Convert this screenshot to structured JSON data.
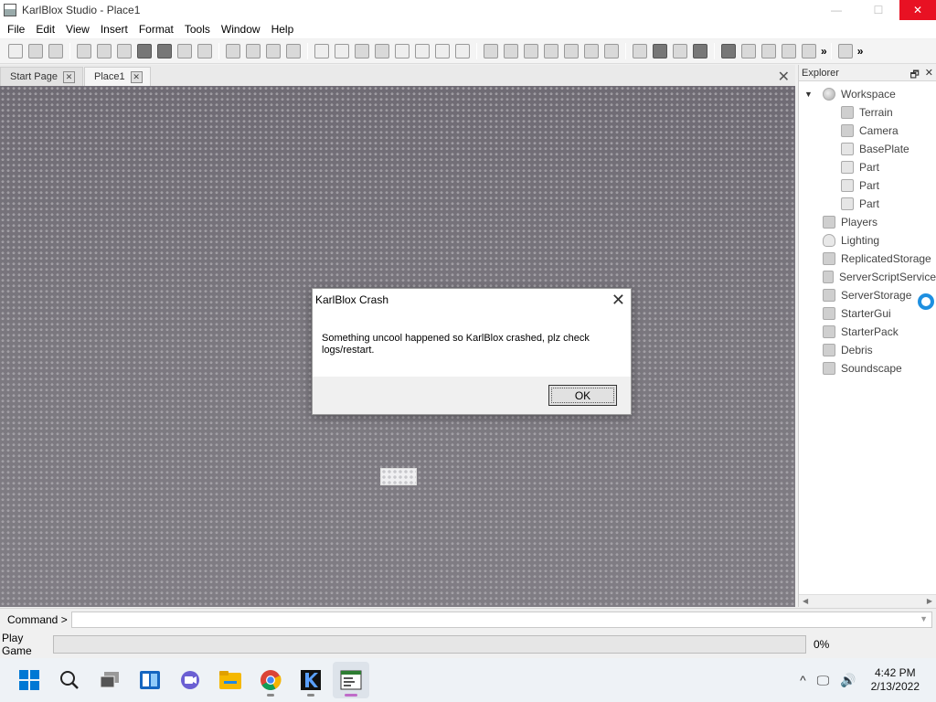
{
  "window": {
    "title": "KarlBlox Studio - Place1",
    "minimize": "—",
    "maximize": "☐",
    "close": "✕"
  },
  "menu": [
    "File",
    "Edit",
    "View",
    "Insert",
    "Format",
    "Tools",
    "Window",
    "Help"
  ],
  "toolbar": {
    "overflow": "»"
  },
  "tabs": [
    {
      "label": "Start Page",
      "close": "✕"
    },
    {
      "label": "Place1",
      "close": "✕"
    }
  ],
  "tabs_close_all": "✕",
  "explorer": {
    "title": "Explorer",
    "float_icon": "🗗",
    "close_icon": "✕",
    "items": [
      {
        "label": "Workspace",
        "icon": "globe-icon",
        "level": 0,
        "expanded": true
      },
      {
        "label": "Terrain",
        "icon": "terrain-icon",
        "level": 1
      },
      {
        "label": "Camera",
        "icon": "camera-icon",
        "level": 1
      },
      {
        "label": "BasePlate",
        "icon": "part-icon",
        "level": 1
      },
      {
        "label": "Part",
        "icon": "part-icon",
        "level": 1
      },
      {
        "label": "Part",
        "icon": "part-icon",
        "level": 1
      },
      {
        "label": "Part",
        "icon": "part-icon",
        "level": 1
      },
      {
        "label": "Players",
        "icon": "players-icon",
        "level": 0
      },
      {
        "label": "Lighting",
        "icon": "lighting-icon",
        "level": 0
      },
      {
        "label": "ReplicatedStorage",
        "icon": "storage-icon",
        "level": 0
      },
      {
        "label": "ServerScriptService",
        "icon": "script-service-icon",
        "level": 0
      },
      {
        "label": "ServerStorage",
        "icon": "storage-icon",
        "level": 0
      },
      {
        "label": "StarterGui",
        "icon": "gui-icon",
        "level": 0
      },
      {
        "label": "StarterPack",
        "icon": "pack-icon",
        "level": 0
      },
      {
        "label": "Debris",
        "icon": "debris-icon",
        "level": 0
      },
      {
        "label": "Soundscape",
        "icon": "sound-icon",
        "level": 0
      }
    ]
  },
  "command": {
    "label": "Command >",
    "value": ""
  },
  "play": {
    "label": "Play Game",
    "progress": 0,
    "progress_text": "0%"
  },
  "dialog": {
    "title": "KarlBlox Crash",
    "message": "Something uncool happened so KarlBlox crashed, plz check logs/restart.",
    "ok_label": "OK",
    "close": "✕"
  },
  "taskbar": {
    "time": "4:42 PM",
    "date": "2/13/2022",
    "tray": [
      "^",
      "🖵",
      "🔊"
    ]
  },
  "colors": {
    "progress_fill": "#06b025",
    "active_app_indicator": "#c06cc9",
    "notification_ring": "#1e8fe0"
  }
}
